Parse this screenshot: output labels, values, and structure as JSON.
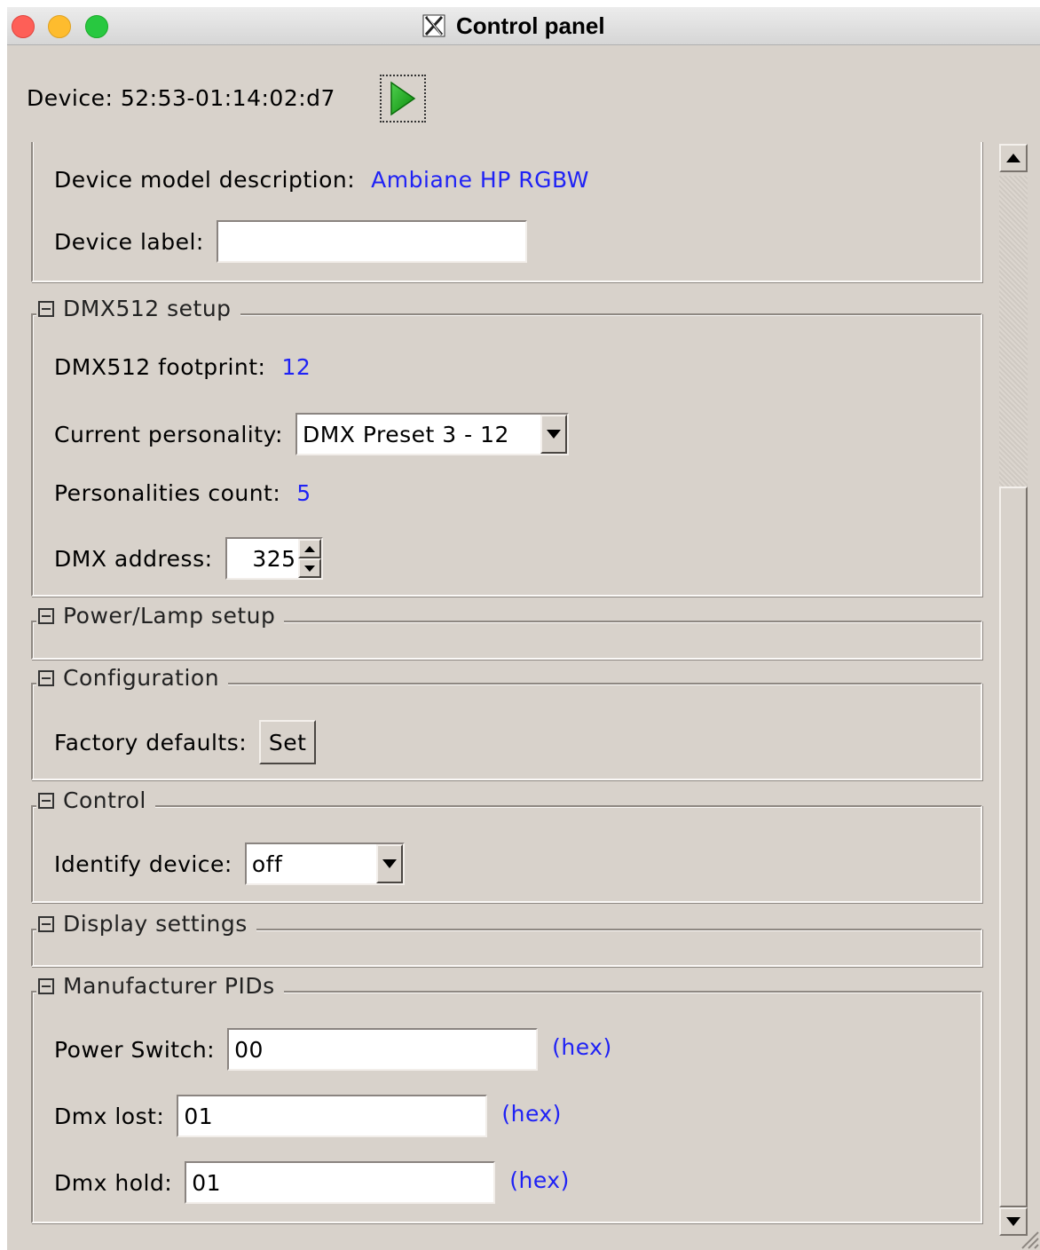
{
  "window": {
    "title": "Control panel",
    "app_icon": "x11-icon"
  },
  "device": {
    "label": "Device:",
    "id": "52:53-01:14:02:d7",
    "play_icon": "play-icon"
  },
  "info": {
    "model_desc_label": "Device model description:",
    "model_desc_value": "Ambiane HP RGBW",
    "device_label_label": "Device label:",
    "device_label_value": ""
  },
  "dmx_setup": {
    "title": "DMX512 setup",
    "footprint_label": "DMX512 footprint:",
    "footprint_value": "12",
    "personality_label": "Current personality:",
    "personality_value": "DMX Preset 3 - 12",
    "personalities_count_label": "Personalities count:",
    "personalities_count_value": "5",
    "address_label": "DMX address:",
    "address_value": "325"
  },
  "power_lamp": {
    "title": "Power/Lamp setup"
  },
  "configuration": {
    "title": "Configuration",
    "factory_label": "Factory defaults:",
    "set_button": "Set"
  },
  "control": {
    "title": "Control",
    "identify_label": "Identify device:",
    "identify_value": "off"
  },
  "display": {
    "title": "Display settings"
  },
  "manufacturer": {
    "title": "Manufacturer PIDs",
    "power_switch_label": "Power Switch:",
    "power_switch_value": "00",
    "dmx_lost_label": "Dmx lost:",
    "dmx_lost_value": "01",
    "dmx_hold_label": "Dmx hold:",
    "dmx_hold_value": "01",
    "hex_suffix": "(hex)"
  }
}
